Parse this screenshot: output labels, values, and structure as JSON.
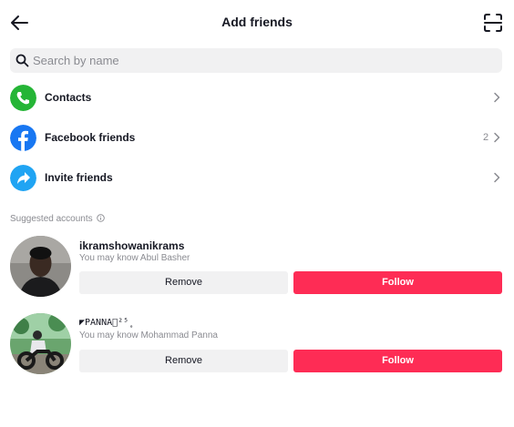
{
  "header": {
    "title": "Add friends",
    "back_icon": "arrow-left-icon",
    "scan_icon": "scan-icon"
  },
  "search": {
    "placeholder": "Search by name",
    "value": "",
    "icon": "search-icon"
  },
  "menu": [
    {
      "label": "Contacts",
      "icon": "phone-icon",
      "icon_color": "#25b536",
      "count": ""
    },
    {
      "label": "Facebook friends",
      "icon": "facebook-icon",
      "icon_color": "#1877f2",
      "count": "2"
    },
    {
      "label": "Invite friends",
      "icon": "share-arrow-icon",
      "icon_color": "#20a4f3",
      "count": ""
    }
  ],
  "suggested": {
    "heading": "Suggested accounts",
    "accounts": [
      {
        "username": "ikramshowanikrams",
        "subtext": "You may know Abul Basher",
        "remove_label": "Remove",
        "follow_label": "Follow"
      },
      {
        "username": "◤PANNA⃒²⁵̥",
        "subtext": "You may know Mohammad Panna",
        "remove_label": "Remove",
        "follow_label": "Follow"
      }
    ]
  },
  "colors": {
    "accent": "#fe2c55",
    "secondary_button": "#f1f1f2",
    "muted_text": "#8a8b91"
  }
}
